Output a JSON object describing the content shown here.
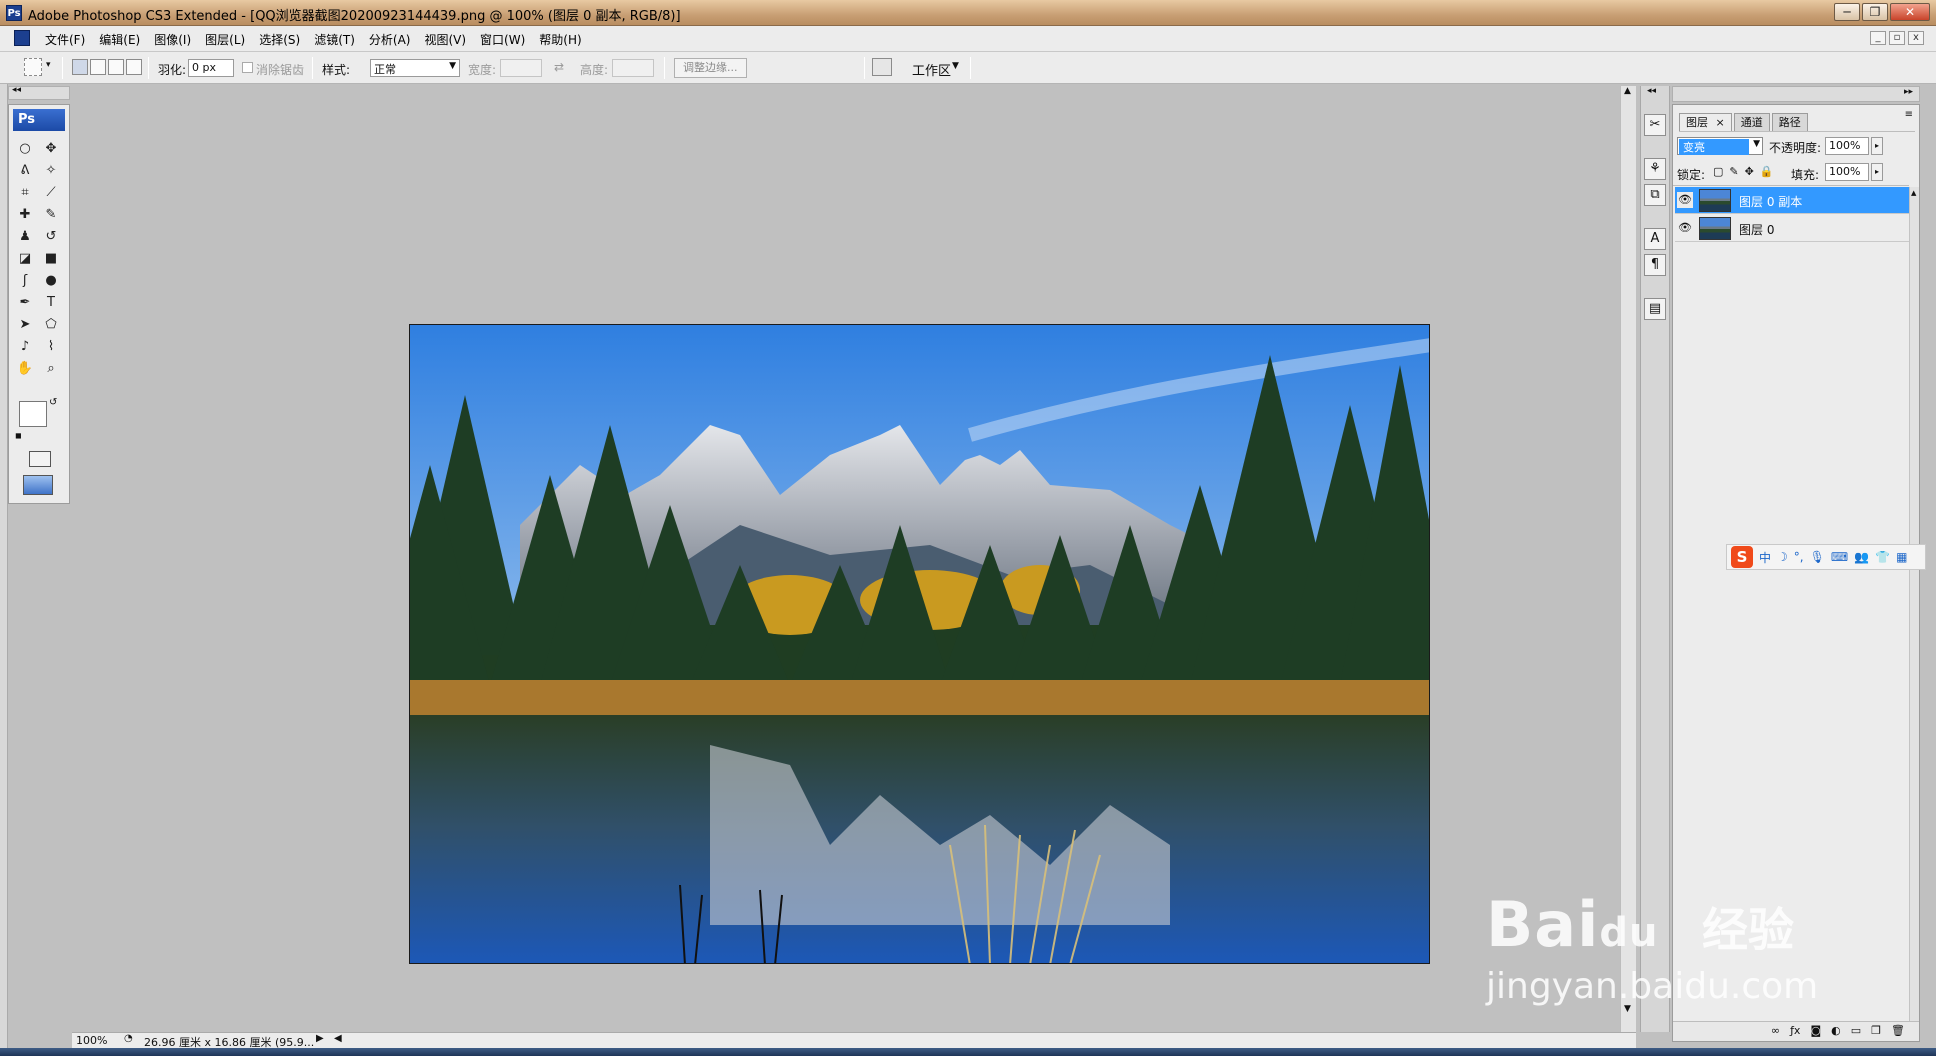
{
  "window": {
    "app_badge": "Ps",
    "title": "Adobe Photoshop CS3 Extended - [QQ浏览器截图20200923144439.png @ 100% (图层 0 副本, RGB/8)]",
    "controls": {
      "minimize": "─",
      "restore": "❐",
      "close": "✕"
    }
  },
  "menubar": {
    "items": [
      {
        "label": "文件(F)"
      },
      {
        "label": "编辑(E)"
      },
      {
        "label": "图像(I)"
      },
      {
        "label": "图层(L)"
      },
      {
        "label": "选择(S)"
      },
      {
        "label": "滤镜(T)"
      },
      {
        "label": "分析(A)"
      },
      {
        "label": "视图(V)"
      },
      {
        "label": "窗口(W)"
      },
      {
        "label": "帮助(H)"
      }
    ],
    "doc_controls": {
      "minimize": "_",
      "restore": "▫",
      "close": "x"
    }
  },
  "options": {
    "feather_label": "羽化:",
    "feather_value": "0 px",
    "antialias_label": "消除锯齿",
    "style_label": "样式:",
    "style_value": "正常",
    "width_label": "宽度:",
    "height_label": "高度:",
    "refine_edge": "调整边缘...",
    "workspace_label": "工作区"
  },
  "toolbox": {
    "logo": "Ps",
    "tools": [
      {
        "icon": "○",
        "name": "elliptical-marquee-icon"
      },
      {
        "icon": "✥",
        "name": "move-icon"
      },
      {
        "icon": "ᕕ",
        "name": "lasso-icon"
      },
      {
        "icon": "✧",
        "name": "magic-wand-icon"
      },
      {
        "icon": "⌗",
        "name": "crop-icon"
      },
      {
        "icon": "⟋",
        "name": "slice-icon"
      },
      {
        "icon": "✚",
        "name": "healing-brush-icon"
      },
      {
        "icon": "✎",
        "name": "brush-icon"
      },
      {
        "icon": "♟",
        "name": "clone-stamp-icon"
      },
      {
        "icon": "↺",
        "name": "history-brush-icon"
      },
      {
        "icon": "◪",
        "name": "eraser-icon"
      },
      {
        "icon": "■",
        "name": "gradient-icon"
      },
      {
        "icon": "ʃ",
        "name": "smudge-icon"
      },
      {
        "icon": "●",
        "name": "dodge-icon"
      },
      {
        "icon": "✒",
        "name": "pen-icon"
      },
      {
        "icon": "T",
        "name": "type-icon"
      },
      {
        "icon": "➤",
        "name": "path-selection-icon"
      },
      {
        "icon": "⬠",
        "name": "shape-icon"
      },
      {
        "icon": "♪",
        "name": "notes-icon"
      },
      {
        "icon": "⌇",
        "name": "eyedropper-icon"
      },
      {
        "icon": "✋",
        "name": "hand-icon"
      },
      {
        "icon": "⌕",
        "name": "zoom-icon"
      }
    ]
  },
  "status": {
    "zoom": "100%",
    "doc_size": "26.96 厘米 x 16.86 厘米 (95.9..."
  },
  "layers_panel": {
    "tabs": [
      {
        "label": "图层",
        "close": "×"
      },
      {
        "label": "通道"
      },
      {
        "label": "路径"
      }
    ],
    "blend_mode": "变亮",
    "opacity_label": "不透明度:",
    "opacity_value": "100%",
    "lock_label": "锁定:",
    "fill_label": "填充:",
    "fill_value": "100%",
    "layers": [
      {
        "name": "图层 0 副本",
        "selected": true
      },
      {
        "name": "图层 0",
        "selected": false
      }
    ],
    "footer_icons": [
      "link-icon",
      "fx-icon",
      "mask-icon",
      "adjustment-icon",
      "group-icon",
      "new-layer-icon",
      "trash-icon"
    ]
  },
  "ime_bar": {
    "logo": "S",
    "items": [
      "中",
      "☽",
      "°,",
      "🎙",
      "⌨",
      "👥",
      "👕",
      "▦"
    ]
  },
  "watermark": {
    "brand": "Bai",
    "brand_suffix": "du",
    "cn": "经验",
    "url": "jingyan.baidu.com"
  },
  "colors": {
    "titlebar": "#c89f74",
    "selected_layer": "#3399ff",
    "chrome": "#ececec",
    "workspace": "#c0c0c0"
  }
}
